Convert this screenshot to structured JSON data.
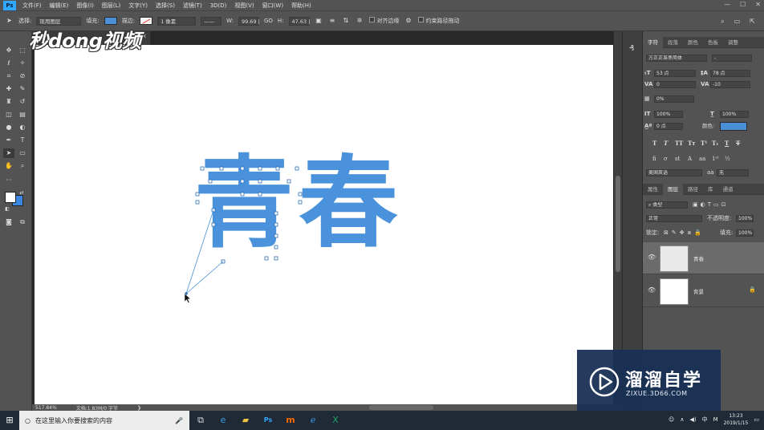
{
  "menubar": {
    "items": [
      "文件(F)",
      "编辑(E)",
      "图像(I)",
      "图层(L)",
      "文字(Y)",
      "选择(S)",
      "滤镜(T)",
      "3D(D)",
      "视图(V)",
      "窗口(W)",
      "帮助(H)"
    ]
  },
  "options": {
    "select_label": "选择:",
    "select_value": "现用图层",
    "fill_label": "填充:",
    "stroke_label": "描边:",
    "stroke_width": "1 像素",
    "w_label": "W:",
    "w_value": "99.69 |",
    "go_label": "GO",
    "h_label": "H:",
    "h_value": "47.63 |",
    "align_edges": "对齐边缘",
    "constrain_path": "约束路径拖动",
    "fill_color": "#4a90d9"
  },
  "document": {
    "watermark_logo": "秒dong视频",
    "text": "青春",
    "text_color": "#4a93dc"
  },
  "status": {
    "zoom": "517.84%",
    "doc_size": "文档:1.83M/0 字节"
  },
  "character_panel": {
    "tabs": [
      "字符",
      "段落",
      "颜色",
      "色板",
      "调整"
    ],
    "font_family": "方正正准黑简体",
    "font_style": "-",
    "size": "53 点",
    "leading": "78 点",
    "kerning": "0",
    "tracking": "-10",
    "scale_h_percent": "0%",
    "vert_scale": "100%",
    "horiz_scale": "100%",
    "baseline": "0 点",
    "color_label": "颜色:",
    "color": "#4a90d9",
    "language": "美国英语",
    "antialias_label": "aa",
    "antialias": "无"
  },
  "layers_panel": {
    "tabs": [
      "属性",
      "图层",
      "路径",
      "库",
      "通道"
    ],
    "filter": "类型",
    "blend_mode": "正常",
    "opacity_label": "不透明度:",
    "opacity": "100%",
    "lock_label": "锁定:",
    "fill_label": "填充:",
    "fill": "100%",
    "layers": [
      {
        "name": "青春"
      },
      {
        "name": "背景"
      }
    ]
  },
  "watermark": {
    "title": "溜溜自学",
    "sub": "ZIXUE.3D66.COM"
  },
  "taskbar": {
    "search_placeholder": "在这里输入你要搜索的内容",
    "ime_lang": "中",
    "time": "13:23",
    "date": "2019/1/15"
  }
}
